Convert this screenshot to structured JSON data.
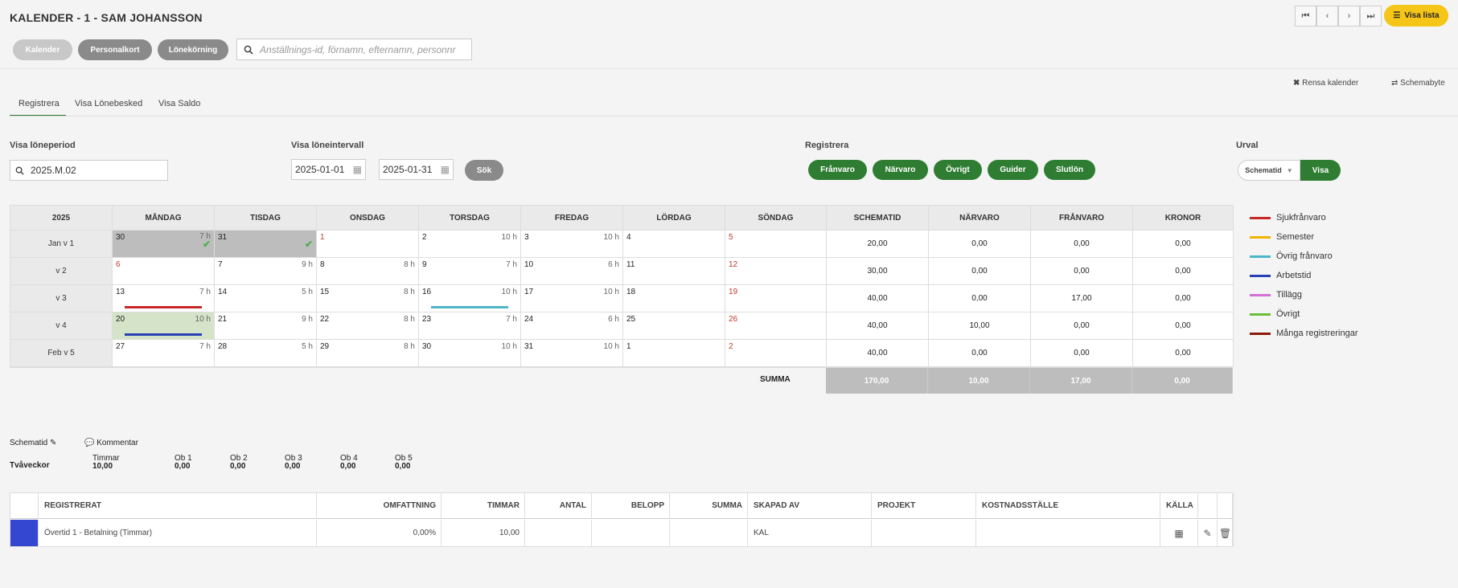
{
  "header": {
    "title": "KALENDER - 1 - SAM JOHANSSON",
    "pills": [
      "Kalender",
      "Personalkort",
      "Lönekörning"
    ],
    "search_placeholder": "Anställnings-id, förnamn, efternamn, personnr",
    "visa_lista": "Visa lista"
  },
  "tools": {
    "rensa": "Rensa kalender",
    "schemabyte": "Schemabyte"
  },
  "tabs": [
    "Registrera",
    "Visa Lönebesked",
    "Visa Saldo"
  ],
  "filters": {
    "period_label": "Visa löneperiod",
    "period_value": "2025.M.02",
    "interval_label": "Visa löneintervall",
    "from": "2025-01-01",
    "to": "2025-01-31",
    "search_btn": "Sök",
    "register_label": "Registrera",
    "register_btns": [
      "Frånvaro",
      "Närvaro",
      "Övrigt",
      "Guider",
      "Slutlön"
    ],
    "urval_label": "Urval",
    "urval_select": "Schematid",
    "urval_btn": "Visa"
  },
  "calendar": {
    "year": "2025",
    "days": [
      "MÅNDAG",
      "TISDAG",
      "ONSDAG",
      "TORSDAG",
      "FREDAG",
      "LÖRDAG",
      "SÖNDAG"
    ],
    "sum_headers": [
      "SCHEMATID",
      "NÄRVARO",
      "FRÅNVARO",
      "KRONOR"
    ],
    "weeks": [
      {
        "label": "Jan v 1",
        "cells": [
          [
            "30",
            "7 h"
          ],
          [
            "31",
            ""
          ],
          [
            "1",
            ""
          ],
          [
            "2",
            "10 h"
          ],
          [
            "3",
            "10 h"
          ],
          [
            "4",
            ""
          ],
          [
            "5",
            ""
          ]
        ],
        "sums": [
          "20,00",
          "0,00",
          "0,00",
          "0,00"
        ]
      },
      {
        "label": "v 2",
        "cells": [
          [
            "6",
            ""
          ],
          [
            "7",
            "9 h"
          ],
          [
            "8",
            "8 h"
          ],
          [
            "9",
            "7 h"
          ],
          [
            "10",
            "6 h"
          ],
          [
            "11",
            ""
          ],
          [
            "12",
            ""
          ]
        ],
        "sums": [
          "30,00",
          "0,00",
          "0,00",
          "0,00"
        ]
      },
      {
        "label": "v 3",
        "cells": [
          [
            "13",
            "7 h"
          ],
          [
            "14",
            "5 h"
          ],
          [
            "15",
            "8 h"
          ],
          [
            "16",
            "10 h"
          ],
          [
            "17",
            "10 h"
          ],
          [
            "18",
            ""
          ],
          [
            "19",
            ""
          ]
        ],
        "sums": [
          "40,00",
          "0,00",
          "17,00",
          "0,00"
        ]
      },
      {
        "label": "v 4",
        "cells": [
          [
            "20",
            "10 h"
          ],
          [
            "21",
            "9 h"
          ],
          [
            "22",
            "8 h"
          ],
          [
            "23",
            "7 h"
          ],
          [
            "24",
            "6 h"
          ],
          [
            "25",
            ""
          ],
          [
            "26",
            ""
          ]
        ],
        "sums": [
          "40,00",
          "10,00",
          "0,00",
          "0,00"
        ]
      },
      {
        "label": "Feb v 5",
        "cells": [
          [
            "27",
            "7 h"
          ],
          [
            "28",
            "5 h"
          ],
          [
            "29",
            "8 h"
          ],
          [
            "30",
            "10 h"
          ],
          [
            "31",
            "10 h"
          ],
          [
            "1",
            ""
          ],
          [
            "2",
            ""
          ]
        ],
        "sums": [
          "40,00",
          "0,00",
          "0,00",
          "0,00"
        ]
      }
    ],
    "summa_label": "SUMMA",
    "totals": [
      "170,00",
      "10,00",
      "17,00",
      "0,00"
    ]
  },
  "legend": [
    {
      "label": "Sjukfrånvaro",
      "color": "#c62828"
    },
    {
      "label": "Semester",
      "color": "#f0b400"
    },
    {
      "label": "Övrig frånvaro",
      "color": "#4db6c8"
    },
    {
      "label": "Arbetstid",
      "color": "#283fb5"
    },
    {
      "label": "Tillägg",
      "color": "#d36fd6"
    },
    {
      "label": "Övrigt",
      "color": "#6abf3a"
    },
    {
      "label": "Många registreringar",
      "color": "#8b1a0e"
    }
  ],
  "schema": {
    "schematid": "Schematid",
    "kommentar": "Kommentar",
    "tvaveckor": "Tvåveckor",
    "cols": [
      {
        "label": "Timmar",
        "value": "10,00"
      },
      {
        "label": "Ob 1",
        "value": "0,00"
      },
      {
        "label": "Ob 2",
        "value": "0,00"
      },
      {
        "label": "Ob 3",
        "value": "0,00"
      },
      {
        "label": "Ob 4",
        "value": "0,00"
      },
      {
        "label": "Ob 5",
        "value": "0,00"
      }
    ]
  },
  "reg_table": {
    "headers": [
      "REGISTRERAT",
      "OMFATTNING",
      "TIMMAR",
      "ANTAL",
      "BELOPP",
      "SUMMA",
      "SKAPAD AV",
      "PROJEKT",
      "KOSTNADSSTÄLLE",
      "KÄLLA"
    ],
    "row": {
      "registrerat": "Övertid 1 - Betalning (Timmar)",
      "omfattning": "0,00%",
      "timmar": "10,00",
      "antal": "",
      "belopp": "",
      "summa": "",
      "skapad_av": "KAL",
      "projekt": "",
      "kostnadsstalle": "",
      "color": "#3347d1"
    }
  }
}
